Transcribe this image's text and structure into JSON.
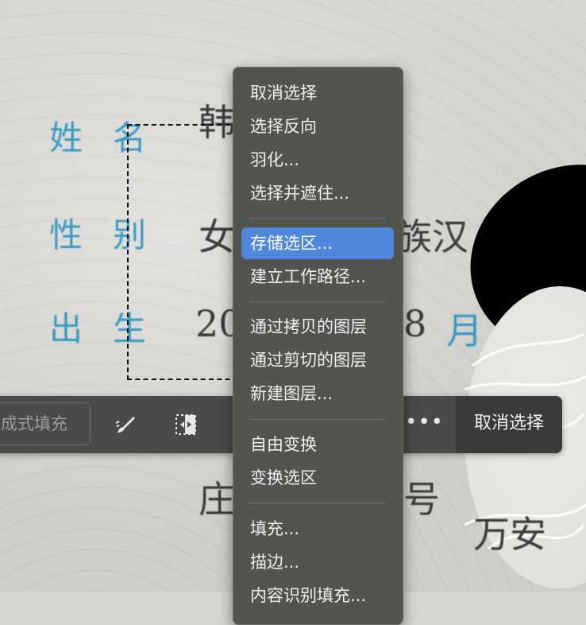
{
  "document": {
    "label_name": "姓名",
    "label_gender": "性别",
    "label_birth": "出生",
    "value_name_partial": "韩",
    "value_gender": "女",
    "value_ethnic": "族汉",
    "value_birth_year_partial": "20",
    "value_birth_month_partial": "8",
    "value_month_label": "月",
    "value_address_partial": "庄",
    "value_address_right": "万安",
    "value_address_mid": "号"
  },
  "taskbar": {
    "generative_fill_label": "成式填充",
    "more_label": "•••",
    "deselect_label": "取消选择",
    "icons": [
      "brush-icon",
      "select-subject-icon"
    ]
  },
  "context_menu": {
    "groups": [
      [
        "取消选择",
        "选择反向",
        "羽化...",
        "选择并遮住..."
      ],
      [
        "存储选区...",
        "建立工作路径..."
      ],
      [
        "通过拷贝的图层",
        "通过剪切的图层",
        "新建图层..."
      ],
      [
        "自由变换",
        "变换选区"
      ],
      [
        "填充...",
        "描边...",
        "内容识别填充..."
      ]
    ],
    "highlighted_item": "存储选区...",
    "highlight_color": "#4f87dd"
  }
}
